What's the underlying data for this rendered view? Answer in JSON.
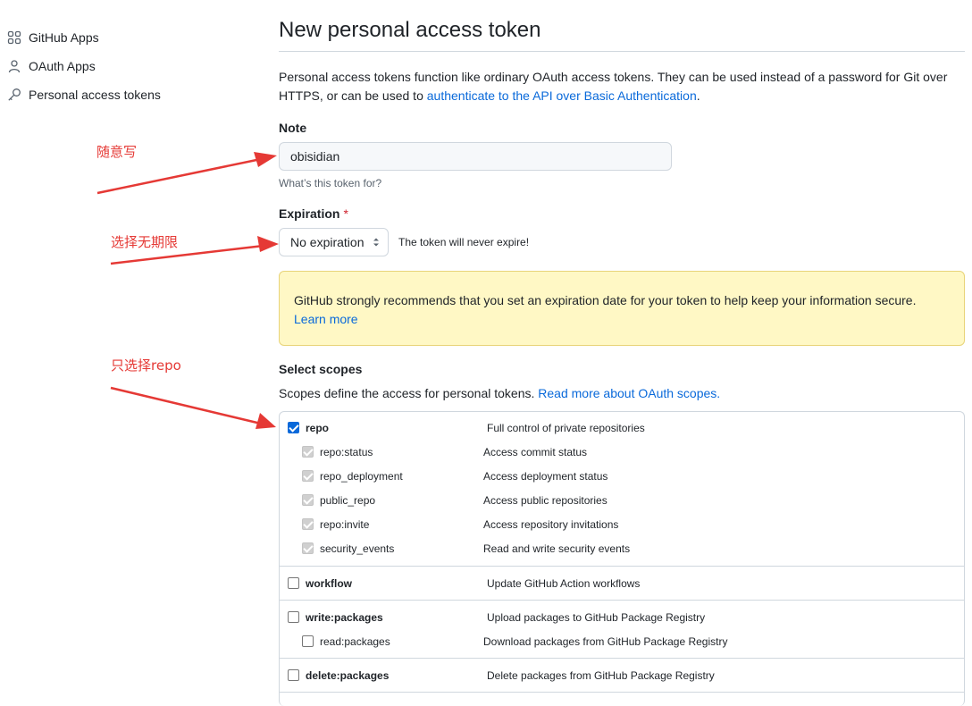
{
  "sidebar": {
    "items": [
      {
        "label": "GitHub Apps",
        "icon": "apps-icon"
      },
      {
        "label": "OAuth Apps",
        "icon": "person-icon"
      },
      {
        "label": "Personal access tokens",
        "icon": "key-icon"
      }
    ]
  },
  "page": {
    "title": "New personal access token",
    "intro_text": "Personal access tokens function like ordinary OAuth access tokens. They can be used instead of a password for Git over HTTPS, or can be used to ",
    "intro_link": "authenticate to the API over Basic Authentication",
    "intro_end": "."
  },
  "note": {
    "label": "Note",
    "value": "obisidian",
    "hint": "What’s this token for?"
  },
  "expiration": {
    "label": "Expiration",
    "required_mark": "*",
    "selected": "No expiration",
    "hint": "The token will never expire!"
  },
  "flash": {
    "text": "GitHub strongly recommends that you set an expiration date for your token to help keep your information secure.",
    "link": "Learn more"
  },
  "scopes": {
    "title": "Select scopes",
    "desc": "Scopes define the access for personal tokens. ",
    "desc_link": "Read more about OAuth scopes.",
    "groups": [
      {
        "name": "repo",
        "desc": "Full control of private repositories",
        "checked": true,
        "children": [
          {
            "name": "repo:status",
            "desc": "Access commit status"
          },
          {
            "name": "repo_deployment",
            "desc": "Access deployment status"
          },
          {
            "name": "public_repo",
            "desc": "Access public repositories"
          },
          {
            "name": "repo:invite",
            "desc": "Access repository invitations"
          },
          {
            "name": "security_events",
            "desc": "Read and write security events"
          }
        ]
      },
      {
        "name": "workflow",
        "desc": "Update GitHub Action workflows",
        "checked": false,
        "children": []
      },
      {
        "name": "write:packages",
        "desc": "Upload packages to GitHub Package Registry",
        "checked": false,
        "children": [
          {
            "name": "read:packages",
            "desc": "Download packages from GitHub Package Registry"
          }
        ]
      },
      {
        "name": "delete:packages",
        "desc": "Delete packages from GitHub Package Registry",
        "checked": false,
        "children": []
      }
    ]
  },
  "annotations": {
    "note_hint": "随意写",
    "expiration_hint": "选择无期限",
    "scope_hint": "只选择repo",
    "color": "#e53935"
  }
}
